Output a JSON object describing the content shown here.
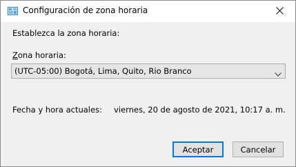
{
  "window": {
    "title": "Configuración de zona horaria",
    "close_icon": "close-icon",
    "app_icon": "time-zone-settings-icon"
  },
  "form": {
    "intro_label": "Establezca la zona horaria:",
    "zone_label_mnemonic": "Z",
    "zone_label_rest": "ona horaria:",
    "zone_selected": "(UTC-05:00) Bogotá, Lima, Quito, Rio Branco",
    "datetime_label": "Fecha y hora actuales:",
    "datetime_value": "viernes, 20 de agosto de 2021, 10:17 a. m."
  },
  "buttons": {
    "ok_label": "Aceptar",
    "cancel_label": "Cancelar"
  },
  "colors": {
    "focus_accent": "#0078d7",
    "dialog_background": "#f0f0f0"
  }
}
